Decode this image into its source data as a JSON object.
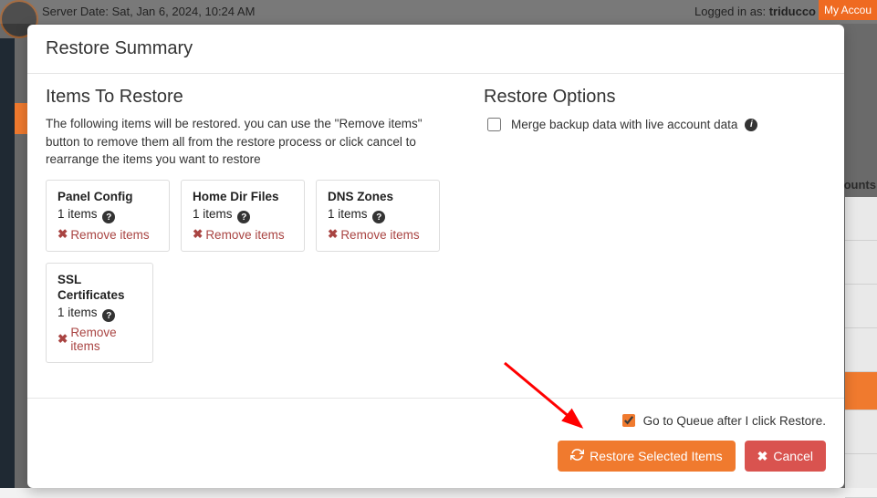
{
  "backdrop": {
    "server_date": "Server Date: Sat, Jan 6, 2024, 10:24 AM",
    "logged_in_prefix": "Logged in as: ",
    "username": "triducco",
    "separator": " | ",
    "my_account": "My Accou",
    "rightcol_header": "ounts"
  },
  "modal": {
    "title": "Restore Summary",
    "left_title": "Items To Restore",
    "left_desc": "The following items will be restored. you can use the \"Remove items\" button to remove them all from the restore process or click cancel to rearrange the items you want to restore",
    "right_title": "Restore Options",
    "merge_label": "Merge backup data with live account data",
    "queue_label": "Go to Queue after I click Restore.",
    "restore_btn": "Restore Selected Items",
    "cancel_btn": "Cancel",
    "remove_label": "Remove items",
    "items": [
      {
        "title": "Panel Config",
        "count": "1 items"
      },
      {
        "title": "Home Dir Files",
        "count": "1 items"
      },
      {
        "title": "DNS Zones",
        "count": "1 items"
      },
      {
        "title": "SSL Certificates",
        "count": "1 items"
      }
    ]
  },
  "colors": {
    "accent": "#f07a2e",
    "danger": "#d9534f",
    "remove_text": "#a94442"
  }
}
